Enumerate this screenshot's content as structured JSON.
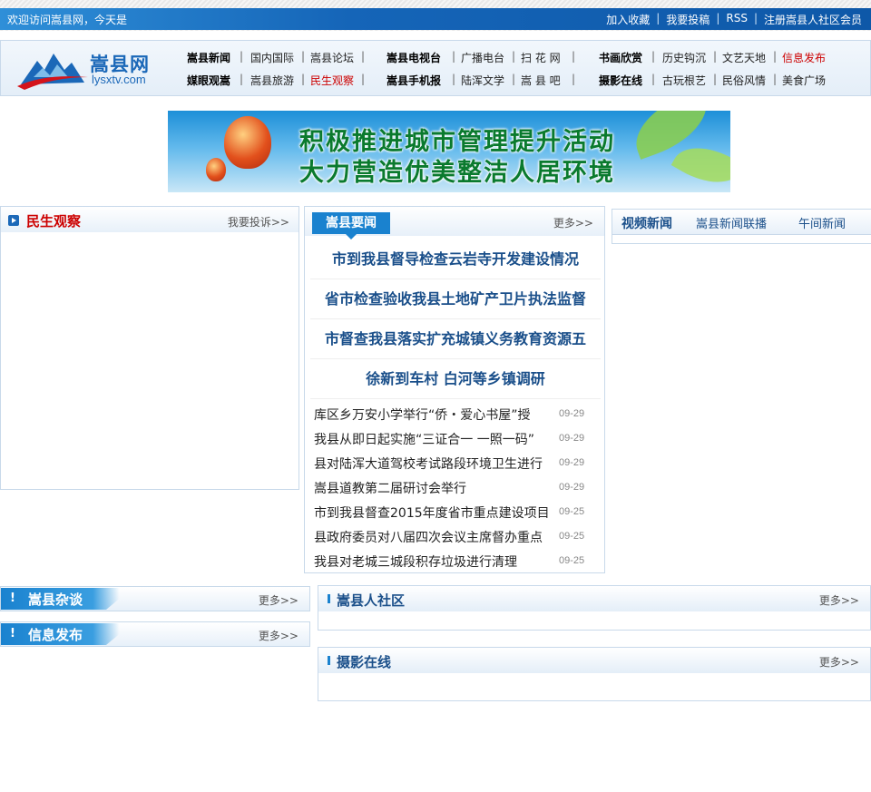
{
  "topbar": {
    "welcome": "欢迎访问嵩县网，今天是",
    "links": [
      "加入收藏",
      "我要投稿",
      "RSS",
      "注册嵩县人社区会员"
    ]
  },
  "logo": {
    "name": "嵩县网",
    "url": "lysxtv.com"
  },
  "nav": {
    "row1": [
      "嵩县新闻",
      "国内国际",
      "嵩县论坛",
      "嵩县电视台",
      "广播电台",
      "扫 花 网",
      "书画欣赏",
      "历史钩沉",
      "文艺天地",
      "信息发布"
    ],
    "row2": [
      "媒眼观嵩",
      "嵩县旅游",
      "民生观察",
      "嵩县手机报",
      "陆浑文学",
      "嵩 县 吧",
      "摄影在线",
      "古玩根艺",
      "民俗风情",
      "美食广场"
    ]
  },
  "banner": {
    "line1": "积极推进城市管理提升活动",
    "line2": "大力营造优美整洁人居环境"
  },
  "minsheng": {
    "title": "民生观察",
    "more": "我要投诉>>"
  },
  "news": {
    "tab": "嵩县要闻",
    "more": "更多>>",
    "headlines": [
      "市到我县督导检查云岩寺开发建设情况",
      "省市检查验收我县土地矿产卫片执法监督",
      "市督查我县落实扩充城镇义务教育资源五",
      "徐新到车村 白河等乡镇调研"
    ],
    "items": [
      {
        "title": "库区乡万安小学举行“侨・爱心书屋”授",
        "date": "09-29"
      },
      {
        "title": "我县从即日起实施“三证合一 一照一码”",
        "date": "09-29"
      },
      {
        "title": "县对陆浑大道驾校考试路段环境卫生进行",
        "date": "09-29"
      },
      {
        "title": "嵩县道教第二届研讨会举行",
        "date": "09-29"
      },
      {
        "title": "市到我县督查2015年度省市重点建设项目",
        "date": "09-25"
      },
      {
        "title": "县政府委员对八届四次会议主席督办重点",
        "date": "09-25"
      },
      {
        "title": "我县对老城三城段积存垃圾进行清理",
        "date": "09-25"
      }
    ]
  },
  "video": {
    "title": "视频新闻",
    "tab1": "嵩县新闻联播",
    "tab2": "午间新闻"
  },
  "zatan": {
    "title": "嵩县杂谈",
    "more": "更多>>"
  },
  "xinxi": {
    "title": "信息发布",
    "more": "更多>>"
  },
  "shequ": {
    "title": "嵩县人社区",
    "more": "更多>>"
  },
  "sheying": {
    "title": "摄影在线",
    "more": "更多>>"
  }
}
